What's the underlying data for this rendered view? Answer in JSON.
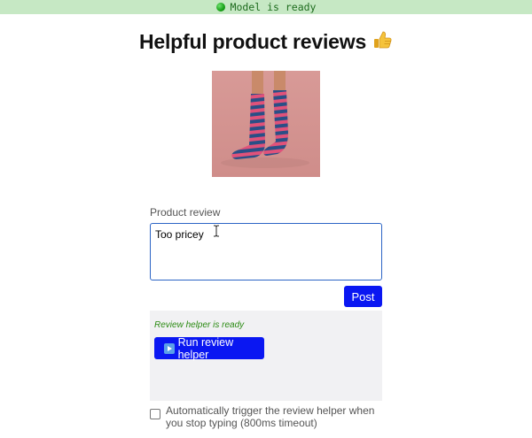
{
  "status": {
    "text": "Model is ready",
    "icon": "green-circle-icon",
    "color": "#16a016"
  },
  "header": {
    "title": "Helpful product reviews",
    "icon": "thumbs-up-icon"
  },
  "product": {
    "image": "striped-socks-image"
  },
  "review": {
    "label": "Product review",
    "value": "Too pricey",
    "placeholder": ""
  },
  "actions": {
    "post_label": "Post"
  },
  "helper": {
    "status_text": "Review helper is ready",
    "run_label": "Run review helper",
    "run_icon": "play-icon"
  },
  "auto_trigger": {
    "label": "Automatically trigger the review helper when you stop typing (800ms timeout)",
    "checked": false
  },
  "colors": {
    "accent": "#0a17f2",
    "focus_border": "#2b64c5",
    "ready_green": "#2a8a12",
    "status_bg": "#c6e8c4"
  }
}
